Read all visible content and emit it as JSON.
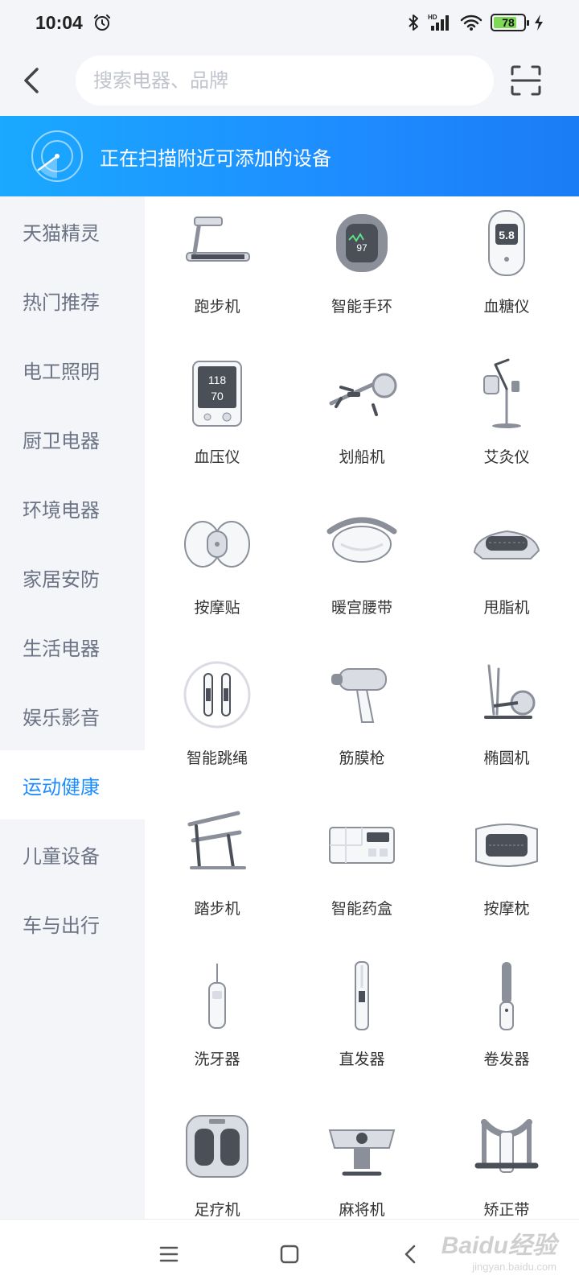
{
  "status_bar": {
    "time": "10:04",
    "battery": "78",
    "battery_level": 0.78,
    "icons": [
      "alarm-icon",
      "bluetooth-icon",
      "hd-signal-icon",
      "wifi-icon",
      "battery-icon",
      "charging-icon"
    ]
  },
  "header": {
    "search_placeholder": "搜索电器、品牌",
    "back_icon": "chevron-left-icon",
    "scan_icon": "scan-icon"
  },
  "banner": {
    "text": "正在扫描附近可添加的设备",
    "icon": "radar-icon"
  },
  "sidebar": {
    "items": [
      {
        "label": "天猫精灵",
        "active": false
      },
      {
        "label": "热门推荐",
        "active": false
      },
      {
        "label": "电工照明",
        "active": false
      },
      {
        "label": "厨卫电器",
        "active": false
      },
      {
        "label": "环境电器",
        "active": false
      },
      {
        "label": "家居安防",
        "active": false
      },
      {
        "label": "生活电器",
        "active": false
      },
      {
        "label": "娱乐影音",
        "active": false
      },
      {
        "label": "运动健康",
        "active": true
      },
      {
        "label": "儿童设备",
        "active": false
      },
      {
        "label": "车与出行",
        "active": false
      }
    ]
  },
  "devices": {
    "items": [
      {
        "label": "跑步机",
        "icon": "treadmill-icon"
      },
      {
        "label": "智能手环",
        "icon": "smart-band-icon",
        "screen_value": "97"
      },
      {
        "label": "血糖仪",
        "icon": "glucose-meter-icon",
        "screen_value": "5.8"
      },
      {
        "label": "血压仪",
        "icon": "blood-pressure-monitor-icon",
        "screen_value_top": "118",
        "screen_value_bottom": "70"
      },
      {
        "label": "划船机",
        "icon": "rowing-machine-icon"
      },
      {
        "label": "艾灸仪",
        "icon": "moxibustion-device-icon"
      },
      {
        "label": "按摩贴",
        "icon": "massage-patch-icon"
      },
      {
        "label": "暖宫腰带",
        "icon": "warming-belt-icon"
      },
      {
        "label": "甩脂机",
        "icon": "vibration-plate-icon"
      },
      {
        "label": "智能跳绳",
        "icon": "smart-jump-rope-icon"
      },
      {
        "label": "筋膜枪",
        "icon": "massage-gun-icon"
      },
      {
        "label": "椭圆机",
        "icon": "elliptical-machine-icon"
      },
      {
        "label": "踏步机",
        "icon": "stepper-icon"
      },
      {
        "label": "智能药盒",
        "icon": "smart-pill-box-icon"
      },
      {
        "label": "按摩枕",
        "icon": "massage-pillow-icon"
      },
      {
        "label": "洗牙器",
        "icon": "water-flosser-icon"
      },
      {
        "label": "直发器",
        "icon": "hair-straightener-icon"
      },
      {
        "label": "卷发器",
        "icon": "curling-iron-icon"
      },
      {
        "label": "足疗机",
        "icon": "foot-massager-icon"
      },
      {
        "label": "麻将机",
        "icon": "mahjong-machine-icon"
      },
      {
        "label": "矫正带",
        "icon": "posture-corrector-icon"
      }
    ]
  },
  "bottom_nav": {
    "icons": [
      "menu-icon",
      "home-square-icon",
      "back-triangle-icon"
    ]
  },
  "watermark": {
    "logo": "Baidu经验",
    "sub": "jingyan.baidu.com"
  },
  "colors": {
    "accent": "#1e8cff",
    "background": "#f4f5f8",
    "sidebar_text": "#6b7385"
  }
}
